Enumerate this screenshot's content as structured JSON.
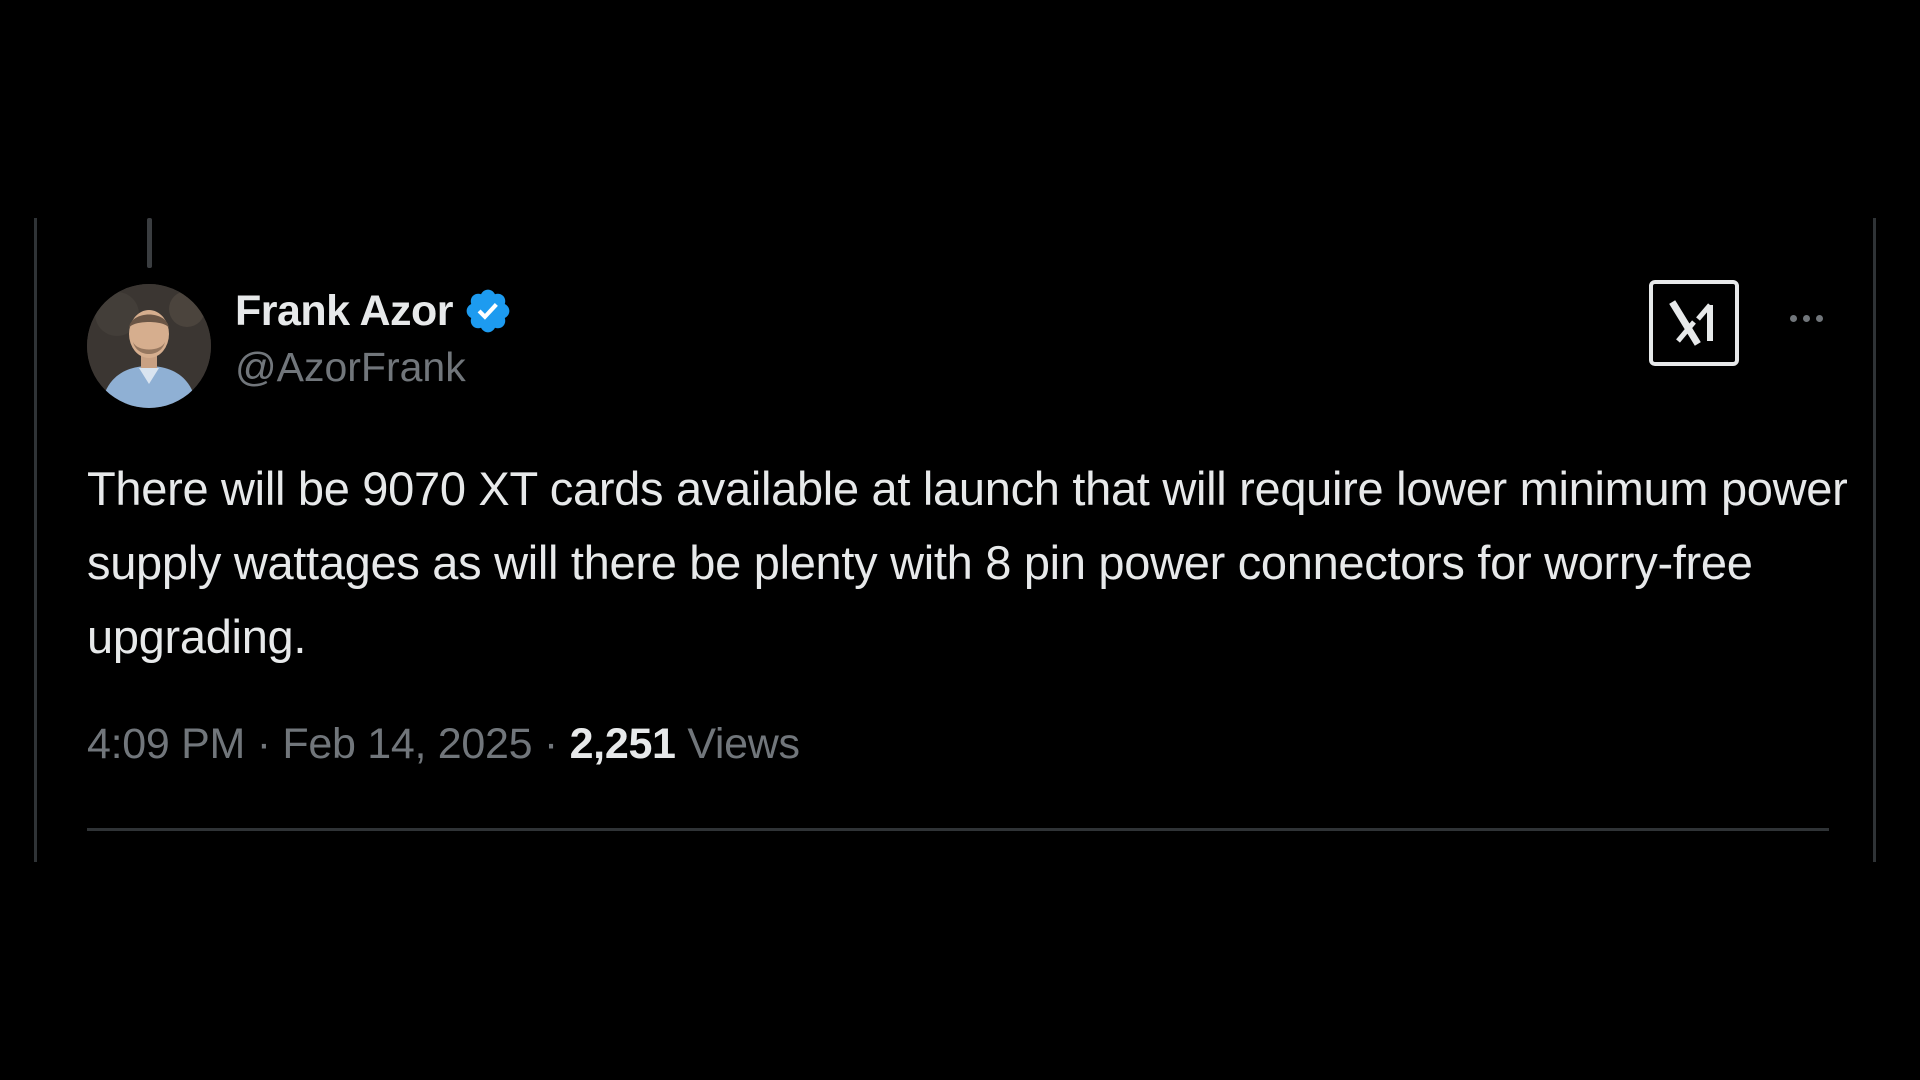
{
  "author": {
    "display_name": "Frank Azor",
    "handle": "@AzorFrank",
    "verified": true,
    "verified_color": "#1d9bf0"
  },
  "tweet": {
    "text": "There will be 9070 XT cards available at launch that will require lower minimum power supply wattages as will there be plenty with 8 pin power connectors for worry-free upgrading.",
    "time": "4:09 PM",
    "separator": "·",
    "date": "Feb 14, 2025",
    "views_count": "2,251",
    "views_label": "Views"
  },
  "icons": {
    "logo": "x-logo-icon",
    "more": "more-horizontal-icon",
    "verified": "verified-badge-icon"
  },
  "colors": {
    "background": "#000000",
    "primary_text": "#e7e9ea",
    "secondary_text": "#71767b",
    "border": "#2f3336"
  }
}
